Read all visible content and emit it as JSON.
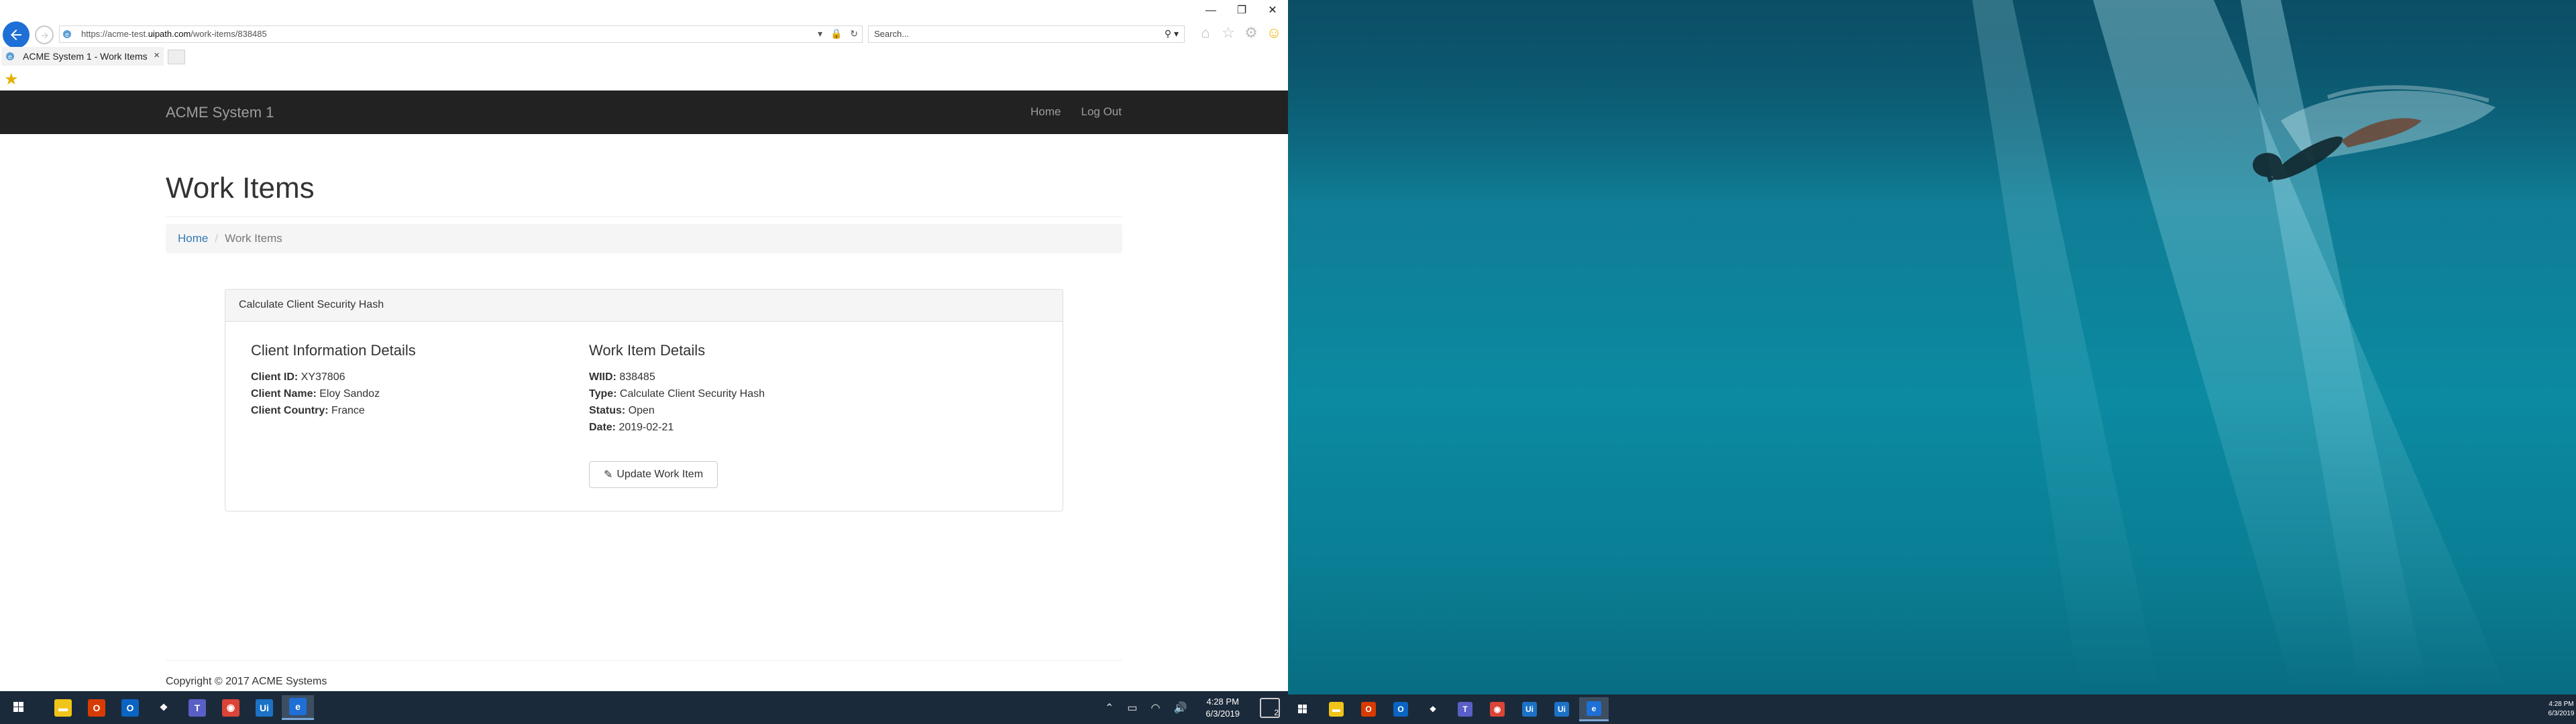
{
  "browser": {
    "url_prefix": "https://acme-test.",
    "url_domain": "uipath.com",
    "url_path": "/work-items/838485",
    "search_placeholder": "Search...",
    "tab_title": "ACME System 1 - Work Items",
    "tab_close": "×"
  },
  "site": {
    "brand": "ACME System 1",
    "nav": [
      "Home",
      "Log Out"
    ]
  },
  "page": {
    "title": "Work Items",
    "breadcrumb": {
      "home": "Home",
      "separator": "/",
      "current": "Work Items"
    },
    "panel_heading": "Calculate Client Security Hash",
    "client": {
      "title": "Client Information Details",
      "rows": [
        {
          "label": "Client ID:",
          "value": " XY37806"
        },
        {
          "label": "Client Name:",
          "value": " Eloy Sandoz"
        },
        {
          "label": "Client Country:",
          "value": " France"
        }
      ]
    },
    "work_item": {
      "title": "Work Item Details",
      "rows": [
        {
          "label": "WIID:",
          "value": " 838485"
        },
        {
          "label": "Type:",
          "value": " Calculate Client Security Hash"
        },
        {
          "label": "Status:",
          "value": " Open"
        },
        {
          "label": "Date:",
          "value": " 2019-02-21"
        }
      ]
    },
    "update_button": "Update Work Item",
    "footer": "Copyright © 2017 ACME Systems"
  },
  "taskbar_left": {
    "time": "4:28 PM",
    "date": "6/3/2019",
    "notifications": "2",
    "apps": [
      {
        "icon": "file-explorer-icon",
        "color": "#f0c419",
        "glyph": "▬"
      },
      {
        "icon": "office-icon",
        "color": "#d83b01",
        "glyph": "O"
      },
      {
        "icon": "outlook-icon",
        "color": "#0a64c2",
        "glyph": "O"
      },
      {
        "icon": "dropbox-icon",
        "color": "#1b2a3a",
        "glyph": "❖"
      },
      {
        "icon": "teams-icon",
        "color": "#5a5fc7",
        "glyph": "T"
      },
      {
        "icon": "chrome-icon",
        "color": "#db4437",
        "glyph": "◉"
      },
      {
        "icon": "uipath-studio-icon",
        "color": "#1b72c6",
        "glyph": "Ui"
      },
      {
        "icon": "internet-explorer-icon",
        "color": "#1e6fd6",
        "glyph": "e"
      }
    ]
  },
  "taskbar_right": {
    "time": "4:28 PM",
    "date": "6/3/2019",
    "apps": [
      {
        "icon": "file-explorer-icon",
        "color": "#f0c419",
        "glyph": "▬"
      },
      {
        "icon": "office-icon",
        "color": "#d83b01",
        "glyph": "O"
      },
      {
        "icon": "outlook-icon",
        "color": "#0a64c2",
        "glyph": "O"
      },
      {
        "icon": "dropbox-icon",
        "color": "#1b2a3a",
        "glyph": "❖"
      },
      {
        "icon": "teams-icon",
        "color": "#5a5fc7",
        "glyph": "T"
      },
      {
        "icon": "chrome-icon",
        "color": "#db4437",
        "glyph": "◉"
      },
      {
        "icon": "uipath-studio-icon",
        "color": "#1b72c6",
        "glyph": "Ui"
      },
      {
        "icon": "uipath-robot-icon",
        "color": "#1b72c6",
        "glyph": "Ui"
      },
      {
        "icon": "internet-explorer-icon",
        "color": "#1e6fd6",
        "glyph": "e"
      }
    ]
  },
  "colors": {
    "navbar": "#222222",
    "link": "#337ab7",
    "taskbar": "#1b2a3a",
    "ie_blue": "#1e6fd6"
  }
}
